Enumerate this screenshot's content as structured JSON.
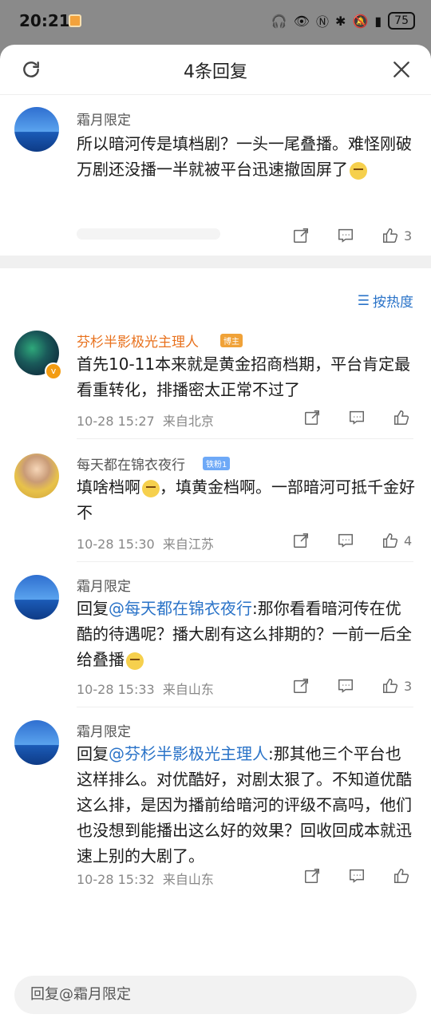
{
  "status": {
    "time": "20:21",
    "battery": "75"
  },
  "header": {
    "title": "4条回复"
  },
  "root_comment": {
    "author": "霜月限定",
    "text": "所以暗河传是填档剧？一头一尾叠播。难怪刚破万剧还没播一半就被平台迅速撤固屏了",
    "likes": "3"
  },
  "sort": {
    "label": "按热度"
  },
  "replies": [
    {
      "author": "芬杉半影极光主理人",
      "badge": "博主",
      "text": "首先10-11本来就是黄金招商档期，平台肯定最看重转化，排播密太正常不过了",
      "time": "10-28 15:27",
      "location": "来自北京",
      "likes": ""
    },
    {
      "author": "每天都在锦衣夜行",
      "badge": "铁粉1",
      "text_a": "填啥档啊",
      "text_b": "，填黄金档啊。一部暗河可抵千金好不",
      "time": "10-28 15:30",
      "location": "来自江苏",
      "likes": "4"
    },
    {
      "author": "霜月限定",
      "reply_prefix": "回复",
      "mention": "@每天都在锦衣夜行",
      "text": ":那你看看暗河传在优酷的待遇呢？播大剧有这么排期的？一前一后全给叠播",
      "time": "10-28 15:33",
      "location": "来自山东",
      "likes": "3"
    },
    {
      "author": "霜月限定",
      "reply_prefix": "回复",
      "mention": "@芬杉半影极光主理人",
      "text": ":那其他三个平台也这样排么。对优酷好，对剧太狠了。不知道优酷这么排，是因为播前给暗河的评级不高吗，他们也没想到能播出这么好的效果？回收回成本就迅速上别的大剧了。",
      "time": "10-28 15:32",
      "location": "来自山东",
      "likes": ""
    }
  ],
  "reply_input": {
    "placeholder": "回复@霜月限定"
  }
}
